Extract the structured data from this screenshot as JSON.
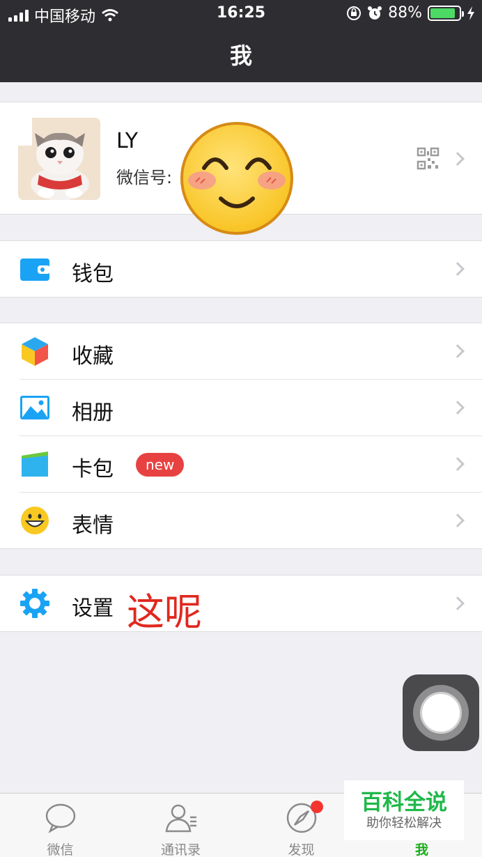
{
  "status_bar": {
    "carrier": "中国移动",
    "time": "16:25",
    "battery": "88%",
    "battery_level": 0.88
  },
  "nav": {
    "title": "我"
  },
  "profile": {
    "name": "LY",
    "wechat_id_label": "微信号:"
  },
  "wallet_group": [
    {
      "label": "钱包",
      "icon": "wallet-icon"
    }
  ],
  "main_group": [
    {
      "label": "收藏",
      "icon": "favorites-cube-icon"
    },
    {
      "label": "相册",
      "icon": "album-picture-icon"
    },
    {
      "label": "卡包",
      "icon": "card-package-icon",
      "badge": "new"
    },
    {
      "label": "表情",
      "icon": "sticker-smiley-icon"
    }
  ],
  "settings": {
    "label": "设置",
    "annotation": "这呢",
    "icon": "gear-icon"
  },
  "tabbar": [
    {
      "label": "微信",
      "icon": "chat-bubble-icon"
    },
    {
      "label": "通讯录",
      "icon": "contacts-icon"
    },
    {
      "label": "发现",
      "icon": "compass-icon"
    },
    {
      "label": "我",
      "icon": "me-icon"
    }
  ],
  "watermark": {
    "title": "百科全说",
    "subtitle": "助你轻松解决"
  },
  "colors": {
    "accent_green": "#1aad19",
    "nav_bg": "#2e2e32",
    "badge_red": "#e84141",
    "annotation_red": "#e0281e",
    "icon_blue": "#1aa3f4"
  }
}
